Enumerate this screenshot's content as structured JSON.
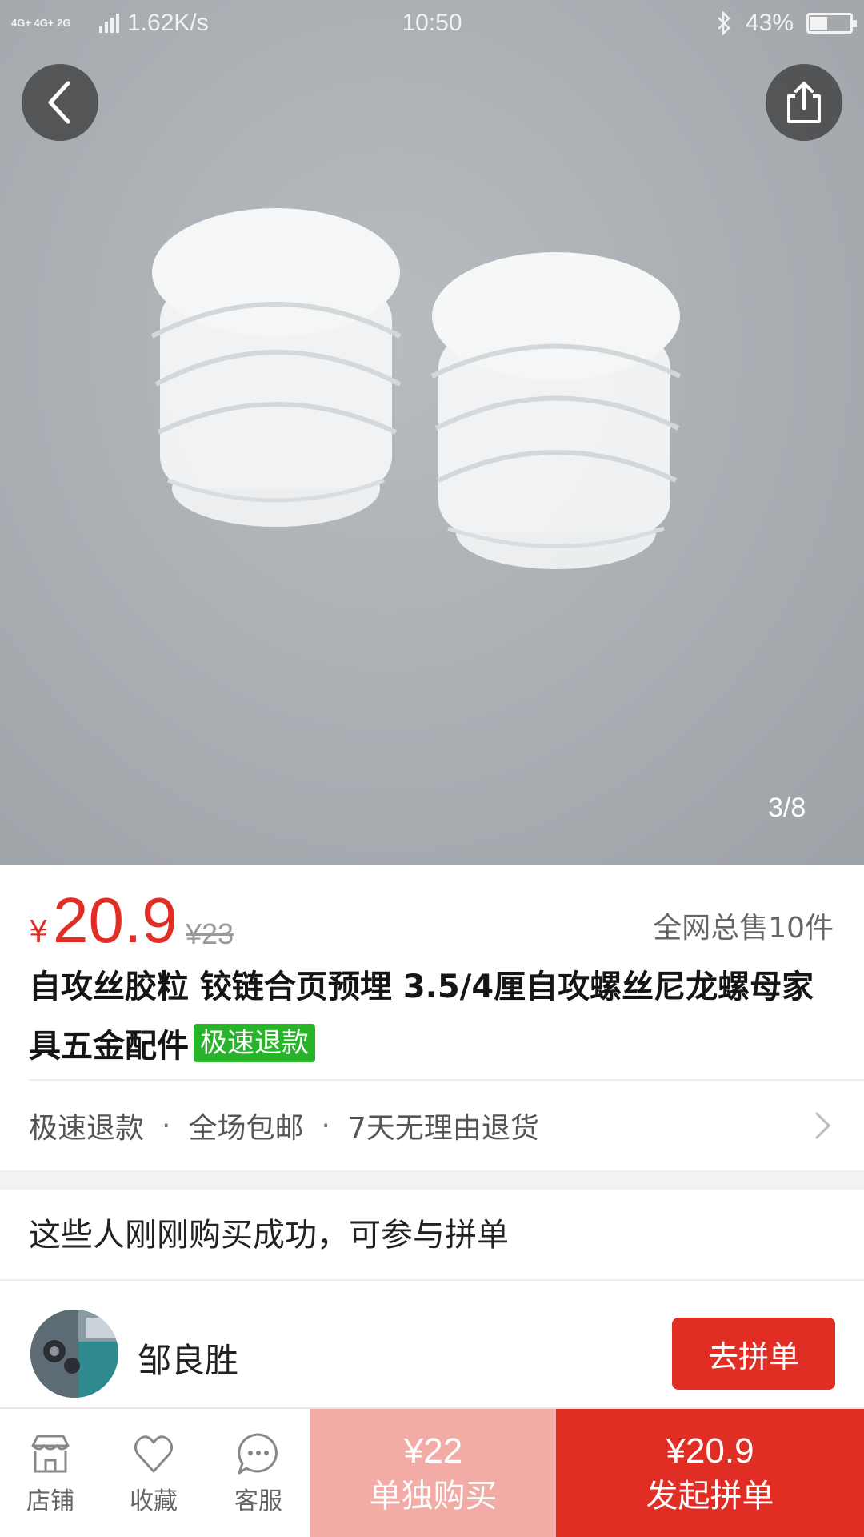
{
  "status_bar": {
    "network": "4G+ 4G+ 2G",
    "speed": "1.62K/s",
    "time": "10:50",
    "battery": "43%",
    "battery_level": 0.43
  },
  "gallery": {
    "page_indicator": "3/8"
  },
  "product": {
    "currency": "¥",
    "price": "20.9",
    "original_price": "¥23",
    "sold_count": "全网总售10件",
    "title": "自攻丝胶粒 铰链合页预埋 3.5/4厘自攻螺丝尼龙螺母家具五金配件",
    "badge": "极速退款"
  },
  "services": {
    "items": [
      "极速退款",
      "全场包邮",
      "7天无理由退货"
    ],
    "separator": "·"
  },
  "group_buy": {
    "heading": "这些人刚刚购买成功，可参与拼单",
    "buyer_name": "邹良胜",
    "join_label": "去拼单"
  },
  "bottom_nav": {
    "shop": "店铺",
    "favorite": "收藏",
    "service": "客服",
    "single_price": "¥22",
    "single_label": "单独购买",
    "group_price": "¥20.9",
    "group_label": "发起拼单"
  },
  "colors": {
    "accent": "#e02e24",
    "badge": "#28b428",
    "single_button": "#f2aba5"
  }
}
